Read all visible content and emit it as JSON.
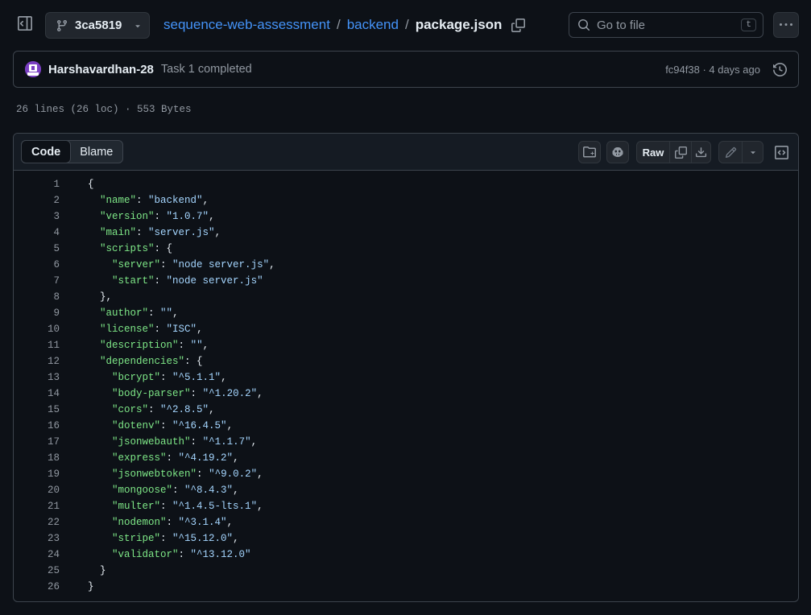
{
  "header": {
    "branch": "3ca5819",
    "breadcrumb": {
      "repo": "sequence-web-assessment",
      "folder": "backend",
      "file": "package.json"
    },
    "search_placeholder": "Go to file",
    "search_shortcut": "t"
  },
  "commit": {
    "author": "Harshavardhan-28",
    "message": "Task 1 completed",
    "sha_time": "fc94f38 · 4 days ago"
  },
  "file_meta": "26 lines (26 loc) · 553 Bytes",
  "toolbar": {
    "tab_code": "Code",
    "tab_blame": "Blame",
    "raw": "Raw"
  },
  "colors": {
    "background": "#0d1117",
    "link": "#4493f8",
    "json_key": "#7ee787",
    "json_string": "#a5d6ff"
  },
  "icons": [
    "sidebar-toggle-icon",
    "branch-icon",
    "copy-icon",
    "search-icon",
    "kebab-icon",
    "history-icon",
    "symbols-icon",
    "copilot-icon",
    "download-icon",
    "pencil-icon",
    "chevron-down-icon",
    "code-view-icon"
  ],
  "code_lines": [
    "{",
    "  \"name\": \"backend\",",
    "  \"version\": \"1.0.7\",",
    "  \"main\": \"server.js\",",
    "  \"scripts\": {",
    "    \"server\": \"node server.js\",",
    "    \"start\": \"node server.js\"",
    "  },",
    "  \"author\": \"\",",
    "  \"license\": \"ISC\",",
    "  \"description\": \"\",",
    "  \"dependencies\": {",
    "    \"bcrypt\": \"^5.1.1\",",
    "    \"body-parser\": \"^1.20.2\",",
    "    \"cors\": \"^2.8.5\",",
    "    \"dotenv\": \"^16.4.5\",",
    "    \"jsonwebauth\": \"^1.1.7\",",
    "    \"express\": \"^4.19.2\",",
    "    \"jsonwebtoken\": \"^9.0.2\",",
    "    \"mongoose\": \"^8.4.3\",",
    "    \"multer\": \"^1.4.5-lts.1\",",
    "    \"nodemon\": \"^3.1.4\",",
    "    \"stripe\": \"^15.12.0\",",
    "    \"validator\": \"^13.12.0\"",
    "  }",
    "}"
  ]
}
